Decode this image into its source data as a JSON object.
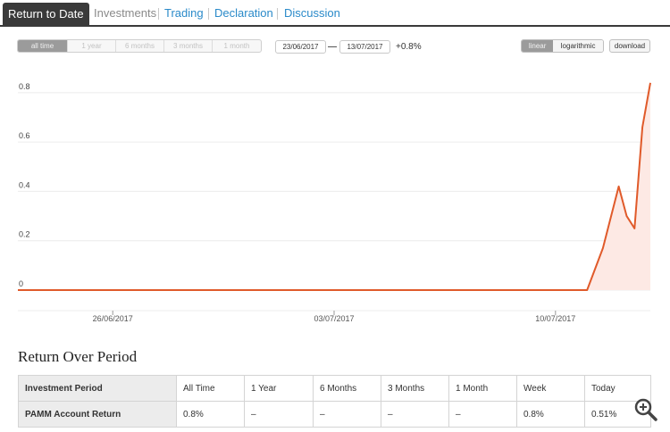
{
  "tabs": [
    {
      "label": "Return to Date",
      "active": true
    },
    {
      "label": "Investments",
      "active": false
    },
    {
      "label": "Trading",
      "active": false
    },
    {
      "label": "Declaration",
      "active": false
    },
    {
      "label": "Discussion",
      "active": false
    }
  ],
  "period_buttons": [
    "all time",
    "1 year",
    "6 months",
    "3 months",
    "1 month"
  ],
  "date_from": "23/06/2017",
  "date_to": "13/07/2017",
  "change": "+0.8%",
  "scale_buttons": [
    "linear",
    "logarithmic"
  ],
  "download_label": "download",
  "colors": {
    "line": "#e05a2a",
    "area": "#fde9e4",
    "active_tab": "#3a3a3a",
    "tab_link": "#2a8ac9"
  },
  "chart_data": {
    "type": "line",
    "y_ticks": [
      "0",
      "0.2",
      "0.4",
      "0.6",
      "0.8"
    ],
    "ylim": [
      0,
      0.85
    ],
    "x_ticks": [
      "26/06/2017",
      "03/07/2017",
      "10/07/2017"
    ],
    "x": [
      "23/06/2017",
      "24/06/2017",
      "25/06/2017",
      "26/06/2017",
      "27/06/2017",
      "28/06/2017",
      "29/06/2017",
      "30/06/2017",
      "01/07/2017",
      "02/07/2017",
      "03/07/2017",
      "04/07/2017",
      "05/07/2017",
      "06/07/2017",
      "07/07/2017",
      "08/07/2017",
      "09/07/2017",
      "10/07/2017",
      "11/07/2017",
      "11/07/2017 12:00",
      "12/07/2017",
      "12/07/2017 06:00",
      "12/07/2017 12:00",
      "12/07/2017 18:00",
      "13/07/2017"
    ],
    "series": [
      {
        "values": [
          0,
          0,
          0,
          0,
          0,
          0,
          0,
          0,
          0,
          0,
          0,
          0,
          0,
          0,
          0,
          0,
          0,
          0,
          0,
          0.17,
          0.42,
          0.3,
          0.25,
          0.66,
          0.84
        ]
      }
    ]
  },
  "return_table": {
    "title": "Return Over Period",
    "header": [
      "Investment Period",
      "All Time",
      "1 Year",
      "6 Months",
      "3 Months",
      "1 Month",
      "Week",
      "Today"
    ],
    "row_label": "PAMM Account Return",
    "row_values": [
      "0.8%",
      "–",
      "–",
      "–",
      "–",
      "0.8%",
      "0.51%"
    ]
  }
}
